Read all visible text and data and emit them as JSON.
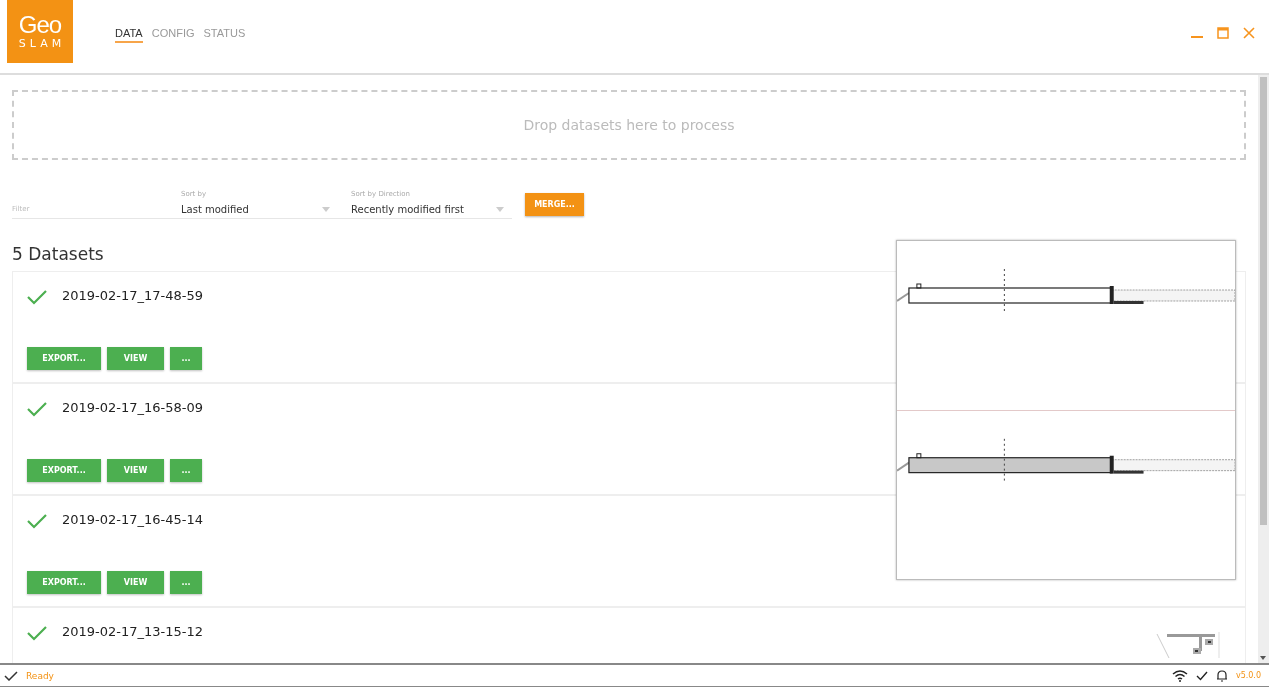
{
  "app": {
    "logo_top": "Geo",
    "logo_bottom": "SLAM"
  },
  "tabs": [
    {
      "label": "DATA",
      "selected": true
    },
    {
      "label": "CONFIG",
      "selected": false
    },
    {
      "label": "STATUS",
      "selected": false
    }
  ],
  "drop_zone": {
    "text": "Drop datasets here to process"
  },
  "filters": {
    "filter": {
      "placeholder": "Filter"
    },
    "sort_by": {
      "label": "Sort by",
      "value": "Last modified"
    },
    "sort_direction": {
      "label": "Sort by Direction",
      "value": "Recently modified first"
    },
    "merge_button": "MERGE..."
  },
  "datasets_heading": "5 Datasets",
  "datasets": [
    {
      "name": "2019-02-17_17-48-59",
      "done": true,
      "buttons": [
        "EXPORT...",
        "VIEW",
        "..."
      ]
    },
    {
      "name": "2019-02-17_16-58-09",
      "done": true,
      "buttons": [
        "EXPORT...",
        "VIEW",
        "..."
      ]
    },
    {
      "name": "2019-02-17_16-45-14",
      "done": true,
      "buttons": [
        "EXPORT...",
        "VIEW",
        "..."
      ]
    },
    {
      "name": "2019-02-17_13-15-12",
      "done": true
    }
  ],
  "status_bar": {
    "status": "Ready",
    "version": "v5.0.0"
  }
}
